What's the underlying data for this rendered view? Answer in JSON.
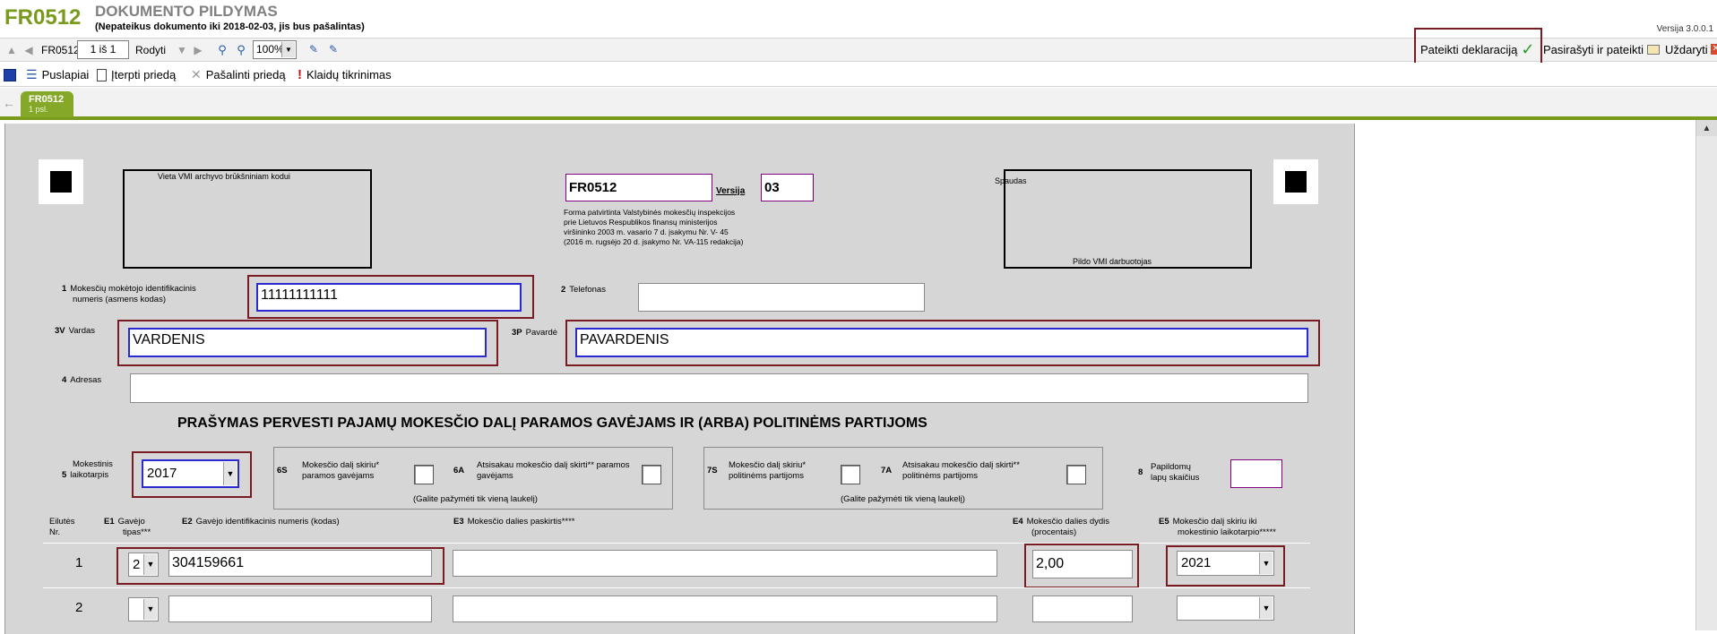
{
  "header": {
    "form_code": "FR0512",
    "title": "DOKUMENTO PILDYMAS",
    "subtitle": "(Nepateikus dokumento iki 2018-02-03, jis bus pašalintas)",
    "version": "Versija 3.0.0.1"
  },
  "toolbar1": {
    "form_label": "FR0512",
    "page_value": "1 iš 1",
    "show_label": "Rodyti",
    "zoom_value": "100%",
    "submit_label": "Pateikti deklaraciją",
    "sign_label": "Pasirašyti ir pateikti",
    "close_label": "Uždaryti"
  },
  "toolbar2": {
    "pages": "Puslapiai",
    "insert_attachment": "Įterpti priedą",
    "remove_attachment": "Pašalinti priedą",
    "error_check": "Klaidų tikrinimas"
  },
  "tab": {
    "name": "FR0512",
    "page": "1 psl."
  },
  "form": {
    "archive_barcode_label": "Vieta VMI archyvo brūkšniniam kodui",
    "form_code_value": "FR0512",
    "version_label": "Versija",
    "version_value": "03",
    "approval_lines": [
      "Forma patvirtinta Valstybinės mokesčių inspekcijos",
      "prie Lietuvos Respublikos finansų ministerijos",
      "viršininko 2003 m. vasario 7 d. įsakymu Nr. V- 45",
      "(2016 m. rugsėjo 20 d. įsakymo Nr. VA-115 redakcija)"
    ],
    "stamp_label": "Spaudas",
    "vmi_staff_label": "Pildo VMI darbuotojas",
    "f1_num": "1",
    "f1_label_1": "Mokesčių mokėtojo identifikacinis",
    "f1_label_2": "numeris (asmens kodas)",
    "f1_value": "11111111111",
    "f2_num": "2",
    "f2_label": "Telefonas",
    "f2_value": "",
    "f3v_num": "3V",
    "f3v_label": "Vardas",
    "f3v_value": "VARDENIS",
    "f3p_num": "3P",
    "f3p_label": "Pavardė",
    "f3p_value": "PAVARDENIS",
    "f4_num": "4",
    "f4_label": "Adresas",
    "f4_value": "",
    "section_title": "PRAŠYMAS PERVESTI PAJAMŲ MOKESČIO DALĮ PARAMOS GAVĖJAMS IR (ARBA) POLITINĖMS PARTIJOMS",
    "f5_num": "5",
    "f5_label_1": "Mokestinis",
    "f5_label_2": "laikotarpis",
    "f5_value": "2017",
    "f6s_num": "6S",
    "f6s_label_1": "Mokesčio dalį skiriu*",
    "f6s_label_2": "paramos gavėjams",
    "f6a_num": "6A",
    "f6a_label_1": "Atsisakau mokesčio dalį skirti** paramos",
    "f6a_label_2": "gavėjams",
    "group1_note": "(Galite pažymėti tik vieną laukelį)",
    "f7s_num": "7S",
    "f7s_label_1": "Mokesčio dalį skiriu*",
    "f7s_label_2": "politinėms partijoms",
    "f7a_num": "7A",
    "f7a_label_1": "Atsisakau mokesčio dalį skirti**",
    "f7a_label_2": "politinėms partijoms",
    "group2_note": "(Galite pažymėti tik vieną laukelį)",
    "f8_num": "8",
    "f8_label_1": "Papildomų",
    "f8_label_2": "lapų skaičius",
    "table": {
      "col_row_1": "Eilutės",
      "col_row_2": "Nr.",
      "col_e1_code": "E1",
      "col_e1_1": "Gavėjo",
      "col_e1_2": "tipas***",
      "col_e2_code": "E2",
      "col_e2": "Gavėjo identifikacinis numeris (kodas)",
      "col_e3_code": "E3",
      "col_e3": "Mokesčio dalies paskirtis****",
      "col_e4_code": "E4",
      "col_e4_1": "Mokesčio dalies dydis",
      "col_e4_2": "(procentais)",
      "col_e5_code": "E5",
      "col_e5_1": "Mokesčio dalį skiriu iki",
      "col_e5_2": "mokestinio laikotarpio*****",
      "rows": [
        {
          "nr": "1",
          "type": "2",
          "code": "304159661",
          "purpose": "",
          "percent": "2,00",
          "year": "2021"
        },
        {
          "nr": "2",
          "type": "",
          "code": "",
          "purpose": "",
          "percent": "",
          "year": ""
        }
      ]
    }
  }
}
